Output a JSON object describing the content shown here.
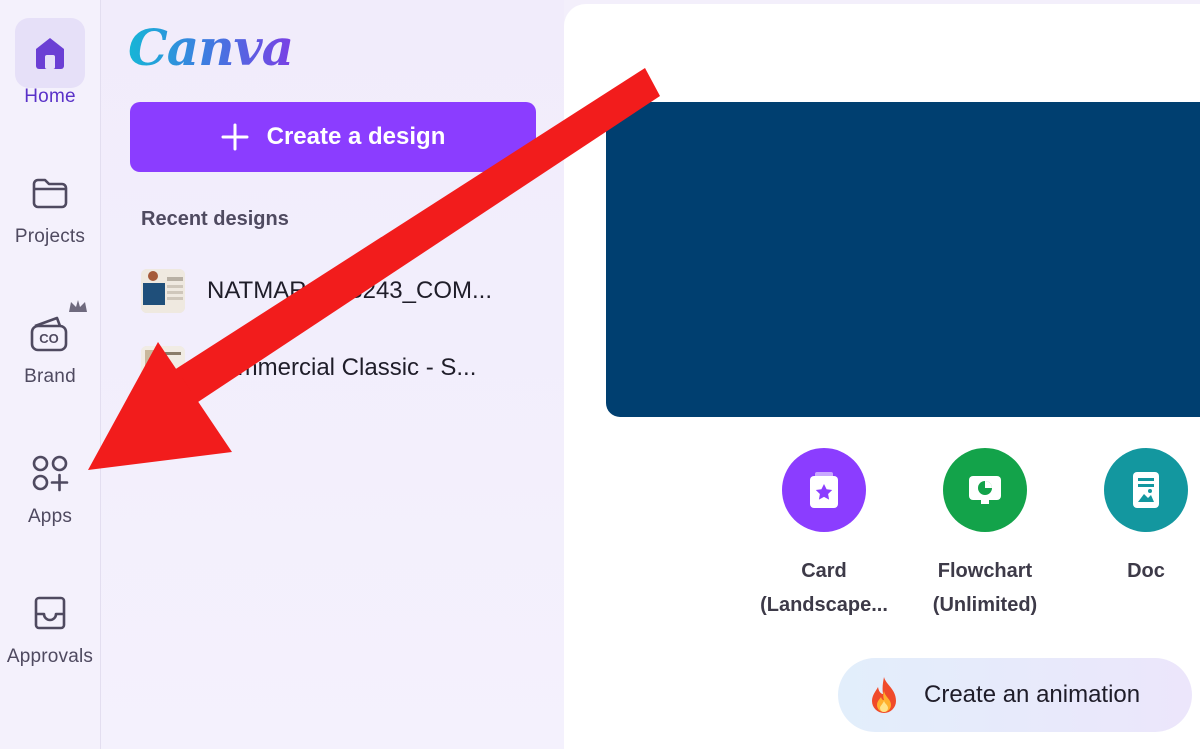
{
  "rail": {
    "items": [
      {
        "label": "Home",
        "icon": "home-icon",
        "active": true
      },
      {
        "label": "Projects",
        "icon": "folder-icon"
      },
      {
        "label": "Brand",
        "icon": "brand-icon",
        "badge": "crown-icon"
      },
      {
        "label": "Apps",
        "icon": "apps-icon"
      },
      {
        "label": "Approvals",
        "icon": "inbox-icon"
      }
    ]
  },
  "panel": {
    "logo": "Canva",
    "create_label": "Create a design",
    "recent_title": "Recent designs",
    "recent": [
      {
        "name": "NATMAR_B23243_COM..."
      },
      {
        "name": "Commercial Classic - S..."
      }
    ]
  },
  "main": {
    "shortcuts": [
      {
        "line1": "Card",
        "line2": "(Landscape...",
        "icon": "card-icon",
        "color": "#8b3dff"
      },
      {
        "line1": "Flowchart",
        "line2": "(Unlimited)",
        "icon": "flowchart-icon",
        "color": "#13a34a"
      },
      {
        "line1": "Doc",
        "line2": "",
        "icon": "doc-icon",
        "color": "#13979f"
      }
    ],
    "animation_label": "Create an animation"
  },
  "colors": {
    "accent": "#8b3dff",
    "hero": "#003f70",
    "annotation_arrow": "#f21c1c"
  }
}
